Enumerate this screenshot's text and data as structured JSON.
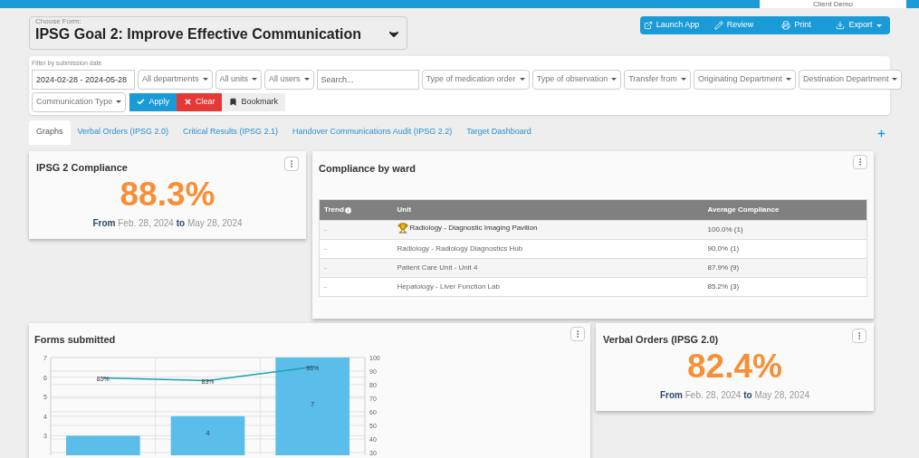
{
  "top_bar": {
    "account": "Client Demo"
  },
  "form_chooser": {
    "label": "Choose Form:",
    "value": "IPSG Goal 2: Improve Effective Communication"
  },
  "actions": [
    {
      "label": "Launch App",
      "kind": "launch"
    },
    {
      "label": "Review",
      "kind": "review"
    },
    {
      "label": "Print",
      "kind": "print"
    },
    {
      "label": "Export",
      "kind": "export"
    }
  ],
  "filters": {
    "date_label": "Filter by submission date",
    "date_range": "2024-02-28 - 2024-05-28",
    "dropdowns": [
      "All departments",
      "All units",
      "All users"
    ],
    "search": {
      "placeholder": "Search..."
    },
    "more_dropdowns": [
      "Type of medication order",
      "Type of observation",
      "Transfer from",
      "Originating Department",
      "Destination Department",
      "Communication Type"
    ],
    "buttons": [
      {
        "label": "Apply",
        "kind": "apply"
      },
      {
        "label": "Clear",
        "kind": "clear"
      },
      {
        "label": "Bookmark",
        "kind": "bookmark"
      }
    ]
  },
  "tabs": [
    {
      "label": "Graphs",
      "selected": true
    },
    {
      "label": "Verbal Orders (IPSG 2.0)",
      "selected": false
    },
    {
      "label": "Critical Results (IPSG 2.1)",
      "selected": false
    },
    {
      "label": "Handover Communications Audit (IPSG 2.2)",
      "selected": false
    },
    {
      "label": "Target Dashboard",
      "selected": false
    }
  ],
  "compliance_card": {
    "title": "IPSG 2 Compliance",
    "value": "88.3%",
    "from_word": "From",
    "from": "Feb. 28, 2024",
    "to_word": "to",
    "to": "May 28, 2024"
  },
  "ward_table": {
    "title": "Compliance by ward",
    "columns": [
      "Trend",
      "Unit",
      "Average Compliance"
    ],
    "rows": [
      {
        "trend": "-",
        "unit": "Radiology - Diagnostic Imaging Pavilion",
        "compliance": "100.0% (1)",
        "top": true
      },
      {
        "trend": "-",
        "unit": "Radiology - Radiology Diagnostics Hub",
        "compliance": "90.0% (1)",
        "top": false
      },
      {
        "trend": "-",
        "unit": "Patient Care Unit - Unit 4",
        "compliance": "87.9% (9)",
        "top": false
      },
      {
        "trend": "-",
        "unit": "Hepatology - Liver Function Lab",
        "compliance": "85.2% (3)",
        "top": false
      }
    ]
  },
  "forms_card": {
    "title": "Forms submitted",
    "chart_data": {
      "type": "bar",
      "stacked": false,
      "grid": true,
      "ylim": [
        2,
        7
      ],
      "yticks": [
        3,
        4,
        5,
        6,
        7
      ],
      "y2lim": [
        28,
        100
      ],
      "y2ticks": [
        30,
        40,
        50,
        60,
        70,
        80,
        90,
        100
      ],
      "series": [
        {
          "type": "bar",
          "color": "#5bbdea",
          "values": [
            3,
            4,
            7
          ],
          "value_labels": [
            null,
            "4",
            "7"
          ]
        },
        {
          "type": "line",
          "axis": "y2",
          "color": "#1aa3b5",
          "values": [
            85,
            83,
            93
          ],
          "value_labels": [
            "85%",
            "83%",
            "93%"
          ]
        }
      ]
    }
  },
  "verbal_card": {
    "title": "Verbal Orders (IPSG 2.0)",
    "value": "82.4%",
    "from_word": "From",
    "from": "Feb. 28, 2024",
    "to_word": "to",
    "to": "May 28, 2024"
  }
}
